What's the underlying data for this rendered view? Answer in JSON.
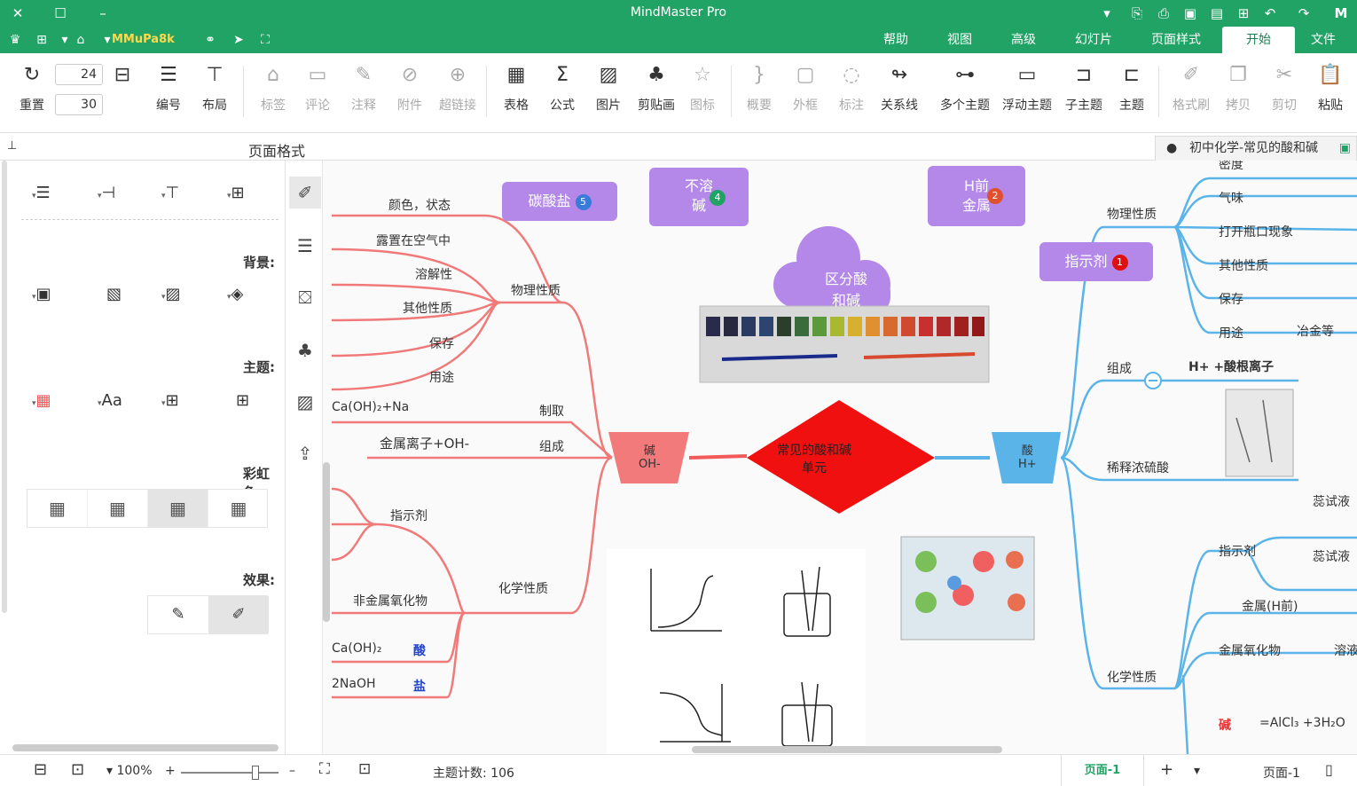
{
  "app_title": "MindMaster Pro",
  "menu_tabs": [
    "文件",
    "开始",
    "页面样式",
    "幻灯片",
    "高级",
    "视图",
    "帮助"
  ],
  "menu_active": "开始",
  "user_label": "MMuPa8k",
  "ribbon": {
    "groups": [
      {
        "label": "粘贴",
        "icon": "paste-icon"
      },
      {
        "label": "剪切",
        "icon": "cut-icon"
      },
      {
        "label": "拷贝",
        "icon": "copy-icon"
      },
      {
        "label": "格式刷",
        "icon": "format-painter-icon"
      },
      {
        "label": "主题",
        "icon": "topic-icon"
      },
      {
        "label": "子主题",
        "icon": "subtopic-icon"
      },
      {
        "label": "浮动主题",
        "icon": "floating-topic-icon"
      },
      {
        "label": "多个主题",
        "icon": "multiple-topics-icon"
      },
      {
        "label": "关系线",
        "icon": "relationship-icon"
      },
      {
        "label": "标注",
        "icon": "callout-icon"
      },
      {
        "label": "外框",
        "icon": "boundary-icon"
      },
      {
        "label": "概要",
        "icon": "summary-icon"
      },
      {
        "label": "图标",
        "icon": "icon-icon"
      },
      {
        "label": "剪贴画",
        "icon": "clipart-icon"
      },
      {
        "label": "图片",
        "icon": "picture-icon"
      },
      {
        "label": "公式",
        "icon": "formula-icon"
      },
      {
        "label": "表格",
        "icon": "table-icon"
      },
      {
        "label": "超链接",
        "icon": "hyperlink-icon"
      },
      {
        "label": "附件",
        "icon": "attachment-icon"
      },
      {
        "label": "注释",
        "icon": "note-icon"
      },
      {
        "label": "评论",
        "icon": "comment-icon"
      },
      {
        "label": "标签",
        "icon": "tag-icon"
      },
      {
        "label": "布局",
        "icon": "layout-icon"
      },
      {
        "label": "编号",
        "icon": "numbering-icon"
      },
      {
        "label": "重置",
        "icon": "reset-icon"
      }
    ],
    "spin_top": "24",
    "spin_bottom": "30"
  },
  "doc_tab": "初中化学-常见的酸和碱",
  "panel_title": "页面格式",
  "left_panel": {
    "background": "背景:",
    "theme": "主题:",
    "rainbow": "彩虹色:",
    "effect": "效果:"
  },
  "mindmap": {
    "central": "常见的酸和碱\n单元",
    "acid": "酸\nH+",
    "base": "碱\nOH-",
    "cloud": "区分酸\n和碱",
    "float_1": "指示剂",
    "float_2": "H前\n金属",
    "float_4": "不溶\n碱",
    "float_5": "碳酸盐",
    "left_branches": [
      "颜色，状态",
      "露置在空气中",
      "溶解性",
      "其他性质",
      "保存",
      "用途",
      "物理性质",
      "制取",
      "组成",
      "指示剂",
      "化学性质",
      "非金属氧化物",
      "Ca(OH)₂",
      "2NaOH",
      "Ca(OH)₂+Na",
      "金属离子+OH-"
    ],
    "left_acid_tag": "酸",
    "left_salt_tag": "盐",
    "right_branches": [
      "物理性质",
      "气味",
      "打开瓶口现象",
      "其他性质",
      "保存",
      "用途",
      "组成",
      "H+ +酸根离子",
      "稀释浓硫酸",
      "指示剂",
      "金属(H前)",
      "金属氧化物",
      "化学性质",
      "冶金等",
      "蕊试液",
      "蕊试液",
      "溶液",
      "=AlCl₃ +3H₂O",
      "碱"
    ],
    "right_top_partial": "密度"
  },
  "status": {
    "page_left": "页面-1",
    "page_active": "页面-1",
    "topic_count": "主题计数: 106",
    "zoom": "100%"
  }
}
